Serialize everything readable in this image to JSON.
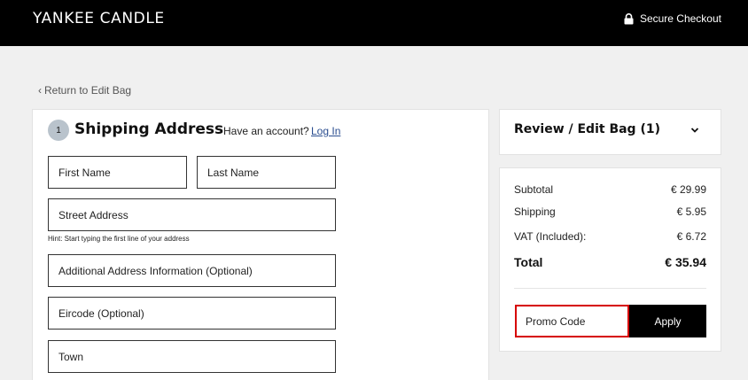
{
  "header": {
    "logo_text": "YANKEE CANDLE",
    "secure_label": "Secure Checkout"
  },
  "nav": {
    "back_label": "Return to Edit Bag"
  },
  "shipping": {
    "step_number": "1",
    "title": "Shipping Address",
    "account_prompt": "Have an account?",
    "login_label": "Log In",
    "fields": {
      "first_name": "First Name",
      "last_name": "Last Name",
      "street": "Street Address",
      "street_hint": "Hint: Start typing the first line of your address",
      "additional": "Additional Address Information (Optional)",
      "eircode": "Eircode (Optional)",
      "town": "Town"
    }
  },
  "review": {
    "title": "Review / Edit Bag (1)"
  },
  "summary": {
    "subtotal_label": "Subtotal",
    "subtotal_value": "€ 29.99",
    "shipping_label": "Shipping",
    "shipping_value": "€ 5.95",
    "vat_label": "VAT (Included):",
    "vat_value": "€ 6.72",
    "total_label": "Total",
    "total_value": "€ 35.94",
    "promo_placeholder": "Promo Code",
    "apply_label": "Apply"
  },
  "colors": {
    "header_bg": "#000000",
    "promo_focus_border": "#d60000",
    "link": "#2a4d8f",
    "step_badge": "#b9c3cc"
  },
  "icons": {
    "lock": "lock-icon",
    "back_chevron": "chevron-left-icon",
    "review_chevron": "chevron-down-icon"
  }
}
